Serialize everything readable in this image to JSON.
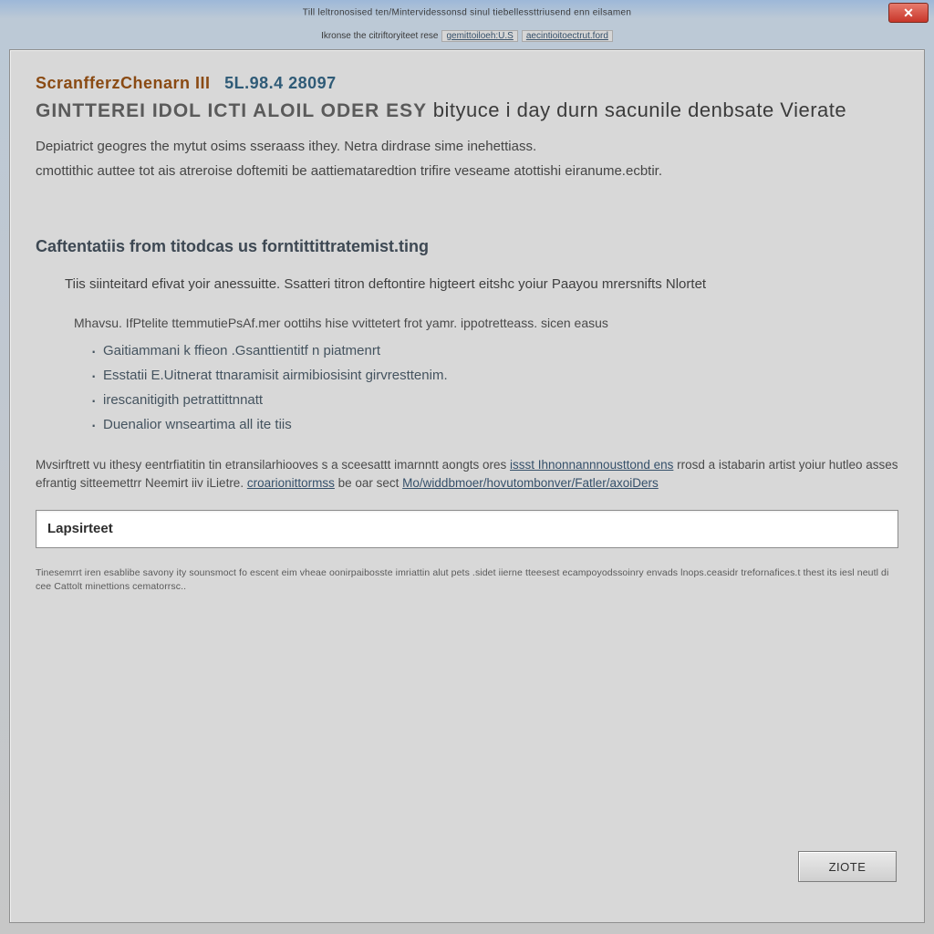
{
  "titlebar": {
    "text": "Till leltronosised ten/Mintervidessonsd sinul tiebellessttriusend enn eilsamen"
  },
  "breadcrumb": {
    "prefix": "Ikronse the citriftoryiteet rese",
    "link1": "gemittoiloeh:U.S",
    "link2": "aecintioitoectrut.ford"
  },
  "header": {
    "product_name": "ScranfferzChenarn III",
    "product_version": "5L.98.4 28097",
    "title_lead": "Gintterei idol icti Aloil oder esy",
    "title_rest": "bityuce i day durn sacunile denbsate Vierate"
  },
  "intro": {
    "p1": "Depiatrict geogres the mytut osims sseraass ithey. Netra dirdrase sime inehettiass.",
    "p2": "cmottithic auttee tot ais atreroise doftemiti be aattiemataredtion trifire veseame atottishi eiranume.ecbtir."
  },
  "section": {
    "heading": "Caftentatiis from titodcas us forntittittratemist.ting",
    "sub": "Tiis siinteitard efivat yoir anessuitte. Ssatteri titron deftontire higteert eitshc yoiur Paayou mrersnifts Nlortet",
    "list_intro": "Mhavsu. IfPtelite ttemmutiePsAf.mer oottihs hise vvittetert frot yamr. ippotretteass. sicen easus"
  },
  "bullets": [
    "Gaitiammani k ffieon .Gsanttientitf n piatmenrt",
    "Esstatii E.Uitnerat ttnaramisit airmibiosisint girvresttenim.",
    "irescanitigith petrattittnnatt",
    "Duenalior wnseartima all ite tiis"
  ],
  "footer_para": {
    "t1": "Mvsirftrett vu ithesy eentrfiatitin tin etransilarhiooves s a sceesattt imarnntt aongts ores ",
    "link1": "issst Ihnonnannnousttond ens",
    "t2": " rrosd a istabarin artist yoiur hutleo asses efrantig sitteemettrr Neemirt iiv iLietre. ",
    "link2": "croarionittormss",
    "t3": " be oar sect ",
    "link3": "Mo/widdbmoer/hovutombonver/Fatler/axoiDers"
  },
  "input": {
    "label": "Lapsirteet"
  },
  "fineprint": "Tinesemrrt iren esablibe savony ity  sounsmoct fo escent eim  vheae oonirpaibosste imriattin alut pets .sidet iierne tteesest ecampoyodssoinry envads lnops.ceasidr trefornafices.t thest its iesl neutl di cee Cattolt minettions cematorrsc..",
  "action": {
    "label": "ZIOTE"
  }
}
